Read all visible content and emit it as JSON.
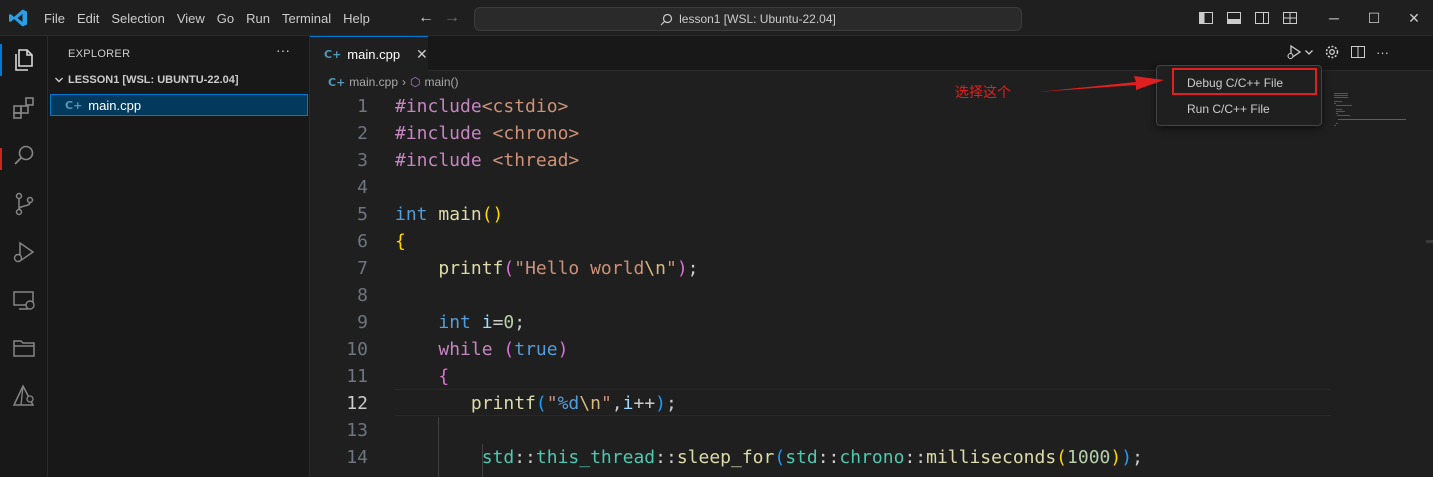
{
  "titlebar": {
    "menu": [
      "File",
      "Edit",
      "Selection",
      "View",
      "Go",
      "Run",
      "Terminal",
      "Help"
    ],
    "search": "lesson1 [WSL: Ubuntu-22.04]"
  },
  "sidebar": {
    "header": "EXPLORER",
    "more": "···",
    "folder": "LESSON1 [WSL: UBUNTU-22.04]",
    "file": "main.cpp"
  },
  "editor": {
    "tab": "main.cpp",
    "breadcrumb": {
      "file": "main.cpp",
      "symbol": "main()"
    },
    "code": [
      {
        "n": "1",
        "parts": [
          [
            "kw",
            "#include"
          ],
          [
            "st",
            "<cstdio>"
          ]
        ]
      },
      {
        "n": "2",
        "parts": [
          [
            "kw",
            "#include"
          ],
          [
            "pl",
            " "
          ],
          [
            "st",
            "<chrono>"
          ]
        ]
      },
      {
        "n": "3",
        "parts": [
          [
            "kw",
            "#include"
          ],
          [
            "pl",
            " "
          ],
          [
            "st",
            "<thread>"
          ]
        ]
      },
      {
        "n": "4",
        "parts": []
      },
      {
        "n": "5",
        "parts": [
          [
            "ty",
            "int"
          ],
          [
            "pl",
            " "
          ],
          [
            "fn",
            "main"
          ],
          [
            "br1",
            "()"
          ]
        ]
      },
      {
        "n": "6",
        "parts": [
          [
            "br1",
            "{"
          ]
        ]
      },
      {
        "n": "7",
        "parts": [
          [
            "pl",
            "    "
          ],
          [
            "fn",
            "printf"
          ],
          [
            "br2",
            "("
          ],
          [
            "st",
            "\"Hello world"
          ],
          [
            "es",
            "\\n"
          ],
          [
            "st",
            "\""
          ],
          [
            "br2",
            ")"
          ],
          [
            "pl",
            ";"
          ]
        ]
      },
      {
        "n": "8",
        "parts": []
      },
      {
        "n": "9",
        "parts": [
          [
            "pl",
            "    "
          ],
          [
            "ty",
            "int"
          ],
          [
            "pl",
            " "
          ],
          [
            "vr",
            "i"
          ],
          [
            "pl",
            "="
          ],
          [
            "nm",
            "0"
          ],
          [
            "pl",
            ";"
          ]
        ]
      },
      {
        "n": "10",
        "parts": [
          [
            "pl",
            "    "
          ],
          [
            "kw",
            "while"
          ],
          [
            "pl",
            " "
          ],
          [
            "br2",
            "("
          ],
          [
            "ty",
            "true"
          ],
          [
            "br2",
            ")"
          ]
        ]
      },
      {
        "n": "11",
        "parts": [
          [
            "pl",
            "    "
          ],
          [
            "br2",
            "{"
          ]
        ]
      },
      {
        "n": "12",
        "parts": [
          [
            "pl",
            "       "
          ],
          [
            "fn",
            "printf"
          ],
          [
            "br3",
            "("
          ],
          [
            "st",
            "\""
          ],
          [
            "ty",
            "%d"
          ],
          [
            "es",
            "\\n"
          ],
          [
            "st",
            "\""
          ],
          [
            "pl",
            ","
          ],
          [
            "vr",
            "i"
          ],
          [
            "pl",
            "++"
          ],
          [
            "br3",
            ")"
          ],
          [
            "pl",
            ";"
          ]
        ]
      },
      {
        "n": "13",
        "parts": []
      },
      {
        "n": "14",
        "parts": [
          [
            "pl",
            "        "
          ],
          [
            "ns",
            "std"
          ],
          [
            "pl",
            "::"
          ],
          [
            "ns",
            "this_thread"
          ],
          [
            "pl",
            "::"
          ],
          [
            "fn",
            "sleep_for"
          ],
          [
            "br3",
            "("
          ],
          [
            "ns",
            "std"
          ],
          [
            "pl",
            "::"
          ],
          [
            "ns",
            "chrono"
          ],
          [
            "pl",
            "::"
          ],
          [
            "fn",
            "milliseconds"
          ],
          [
            "br1",
            "("
          ],
          [
            "nm",
            "1000"
          ],
          [
            "br1",
            ")"
          ],
          [
            "br3",
            ")"
          ],
          [
            "pl",
            ";"
          ]
        ]
      }
    ],
    "current_line": "12"
  },
  "run_menu": {
    "items": [
      "Debug C/C++ File",
      "Run C/C++ File"
    ],
    "highlighted": "Debug C/C++ File"
  },
  "annotation": {
    "text": "选择这个",
    "color": "#e02020"
  },
  "colors": {
    "accent": "#0078d4",
    "annotation": "#e02020"
  }
}
